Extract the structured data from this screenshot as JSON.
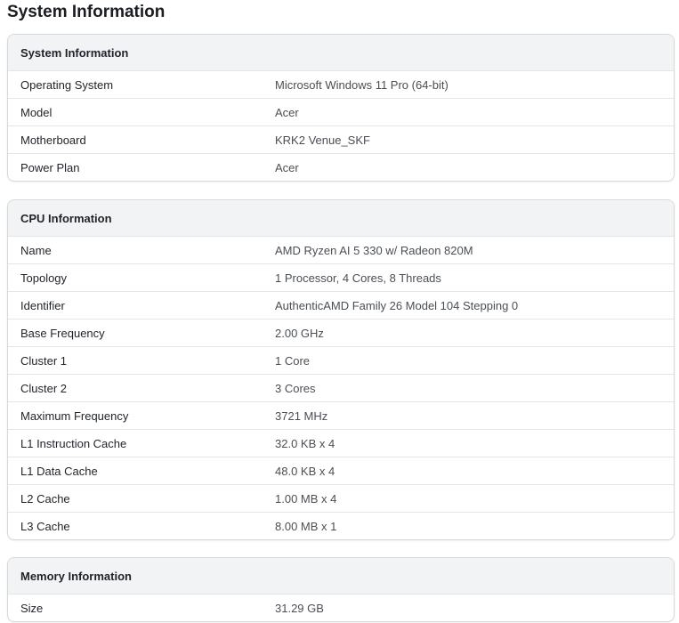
{
  "page": {
    "title": "System Information"
  },
  "sections": [
    {
      "title": "System Information",
      "rows": [
        {
          "label": "Operating System",
          "value": "Microsoft Windows 11 Pro (64-bit)"
        },
        {
          "label": "Model",
          "value": "Acer"
        },
        {
          "label": "Motherboard",
          "value": "KRK2 Venue_SKF"
        },
        {
          "label": "Power Plan",
          "value": "Acer"
        }
      ]
    },
    {
      "title": "CPU Information",
      "rows": [
        {
          "label": "Name",
          "value": "AMD Ryzen AI 5 330 w/ Radeon 820M"
        },
        {
          "label": "Topology",
          "value": "1 Processor, 4 Cores, 8 Threads"
        },
        {
          "label": "Identifier",
          "value": "AuthenticAMD Family 26 Model 104 Stepping 0"
        },
        {
          "label": "Base Frequency",
          "value": "2.00 GHz"
        },
        {
          "label": "Cluster 1",
          "value": "1 Core"
        },
        {
          "label": "Cluster 2",
          "value": "3 Cores"
        },
        {
          "label": "Maximum Frequency",
          "value": "3721 MHz"
        },
        {
          "label": "L1 Instruction Cache",
          "value": "32.0 KB x 4"
        },
        {
          "label": "L1 Data Cache",
          "value": "48.0 KB x 4"
        },
        {
          "label": "L2 Cache",
          "value": "1.00 MB x 4"
        },
        {
          "label": "L3 Cache",
          "value": "8.00 MB x 1"
        }
      ]
    },
    {
      "title": "Memory Information",
      "rows": [
        {
          "label": "Size",
          "value": "31.29 GB"
        }
      ]
    }
  ]
}
